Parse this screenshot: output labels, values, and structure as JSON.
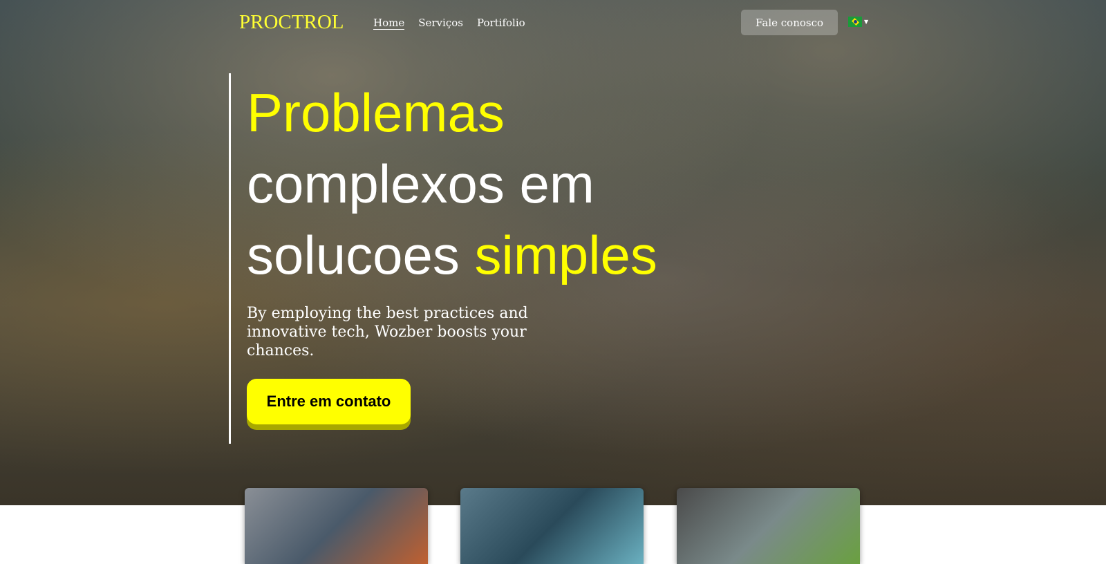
{
  "nav": {
    "logo": "PROCTROL",
    "links": [
      {
        "label": "Home",
        "active": true
      },
      {
        "label": "Serviços"
      },
      {
        "label": "Portifolio"
      }
    ],
    "contact_button": "Fale conosco",
    "language_icon": "brazil-flag-icon"
  },
  "hero": {
    "title_line1": "Problemas",
    "title_line2": "complexos em",
    "title_line3_a": "solucoes ",
    "title_line3_b": "simples",
    "subtitle": "By employing the best practices and innovative tech, Wozber boosts your chances.",
    "cta": "Entre em contato"
  },
  "colors": {
    "accent": "#ffff00"
  },
  "cards": [
    {
      "image": "electrician-with-multimeter"
    },
    {
      "image": "engineer-at-control-panel"
    },
    {
      "image": "technician-with-ear-protection"
    }
  ]
}
